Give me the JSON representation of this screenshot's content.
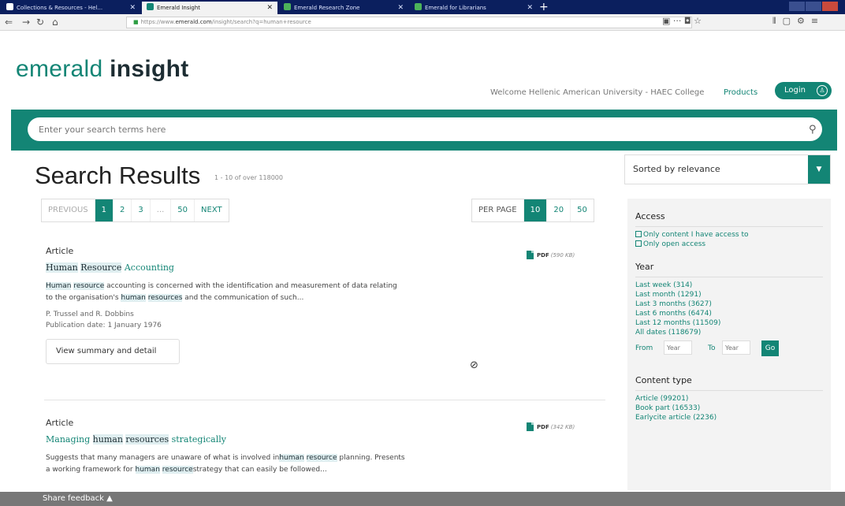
{
  "browser": {
    "tabs": [
      {
        "title": "Collections & Resources - Hel..."
      },
      {
        "title": "Emerald Insight"
      },
      {
        "title": "Emerald Research Zone"
      },
      {
        "title": "Emerald for Librarians"
      }
    ],
    "new_tab": "+",
    "url_prefix": "https://www.",
    "url_domain": "emerald.com",
    "url_path": "/insight/search?q=human+resource"
  },
  "header": {
    "logo_a": "emerald",
    "logo_b": "insight",
    "welcome": "Welcome Hellenic American University - HAEC College",
    "products": "Products",
    "login": "Login",
    "search_placeholder": "Enter your search terms here"
  },
  "results": {
    "title": "Search Results",
    "count": "1 - 10 of over 118000",
    "pagination": {
      "previous": "PREVIOUS",
      "pages": [
        "1",
        "2",
        "3",
        "...",
        "50"
      ],
      "current": "1",
      "next": "NEXT"
    },
    "per_page": {
      "label": "PER PAGE",
      "options": [
        "10",
        "20",
        "50"
      ],
      "current": "10"
    },
    "items": [
      {
        "type": "Article",
        "title_parts": [
          "Human",
          " ",
          "Resource",
          " Accounting"
        ],
        "abstract_parts": [
          "Human",
          " ",
          "resource",
          " accounting is concerned with the identification and measurement of data relating",
          "to the organisation's ",
          "human",
          " ",
          "resources",
          " and the communication of such..."
        ],
        "authors": "P. Trussel and R. Dobbins",
        "date": "Publication date: 1 January 1976",
        "button": "View summary and detail",
        "pdf_label": "PDF",
        "pdf_size": "(590 KB)"
      },
      {
        "type": "Article",
        "title_parts": [
          "Managing ",
          "human",
          " ",
          "resources",
          " strategically"
        ],
        "abstract_parts": [
          "Suggests that many managers are unaware of what is involved in",
          "human",
          " ",
          "resource",
          " planning. Presents",
          "a working framework for ",
          "human",
          " ",
          "resource",
          "strategy that can easily be followed..."
        ],
        "pdf_label": "PDF",
        "pdf_size": "(342 KB)"
      }
    ]
  },
  "sidebar": {
    "sort": "Sorted by relevance",
    "access": {
      "heading": "Access",
      "options": [
        "Only content I have access to",
        "Only open access"
      ]
    },
    "year": {
      "heading": "Year",
      "links": [
        "Last week (314)",
        "Last month (1291)",
        "Last 3 months (3627)",
        "Last 6 months (6474)",
        "Last 12 months (11509)",
        "All dates (118679)"
      ],
      "from_label": "From",
      "to_label": "To",
      "year_placeholder": "Year",
      "go": "Go"
    },
    "content_type": {
      "heading": "Content type",
      "links": [
        "Article (99201)",
        "Book part (16533)",
        "Earlycite article (2236)"
      ]
    }
  },
  "footer": {
    "feedback": "Share feedback ▲"
  },
  "colors": {
    "accent": "#138575",
    "dark": "#1d2d33",
    "tabbar": "#0b1f5e",
    "highlight": "#dfeef0",
    "feedback_bar": "#777777"
  }
}
